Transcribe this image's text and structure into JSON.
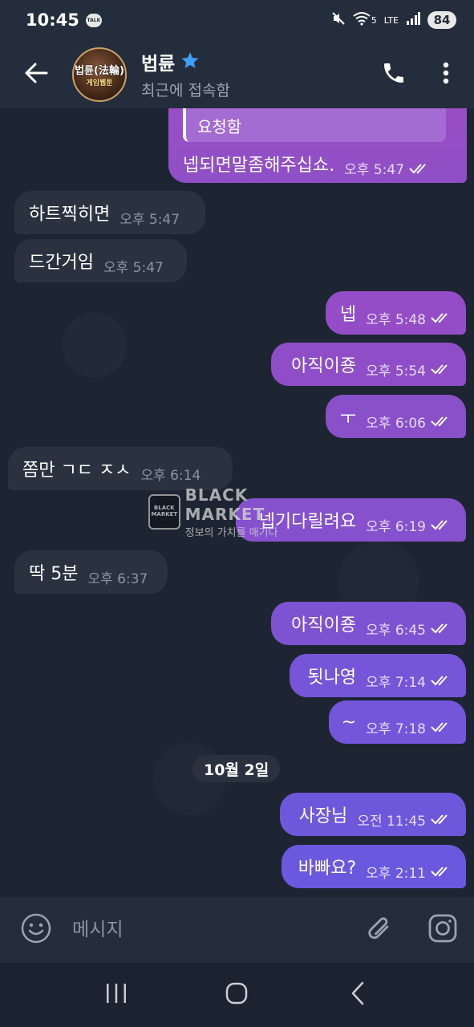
{
  "status_bar": {
    "time": "10:45",
    "talk_badge": "TALK",
    "network": "5",
    "lte": "LTE",
    "battery": "84"
  },
  "header": {
    "name": "법륜",
    "status": "최근에 접속함",
    "avatar_text_1": "법륜(法輪)",
    "avatar_text_2": "게임웹툰"
  },
  "colors": {
    "outgoing_bubble_top": "#9a4ec6",
    "outgoing_bubble_bottom": "#5c5ee6",
    "incoming_bubble": "#2a3240",
    "header_bg": "#242d3b",
    "star": "#3d9ef5"
  },
  "reply_snippet": {
    "quoted": "요청함",
    "text": "넵되면말좀해주십쇼.",
    "time": "오후 5:47"
  },
  "messages": [
    {
      "side": "in",
      "text": "하트찍히면",
      "time": "오후 5:47"
    },
    {
      "side": "in",
      "text": "드간거임",
      "time": "오후 5:47"
    },
    {
      "side": "out",
      "text": "넵",
      "time": "오후 5:48"
    },
    {
      "side": "out",
      "text": "아직이죵",
      "time": "오후 5:54"
    },
    {
      "side": "out",
      "text": "ㅜ",
      "time": "오후 6:06"
    },
    {
      "side": "in",
      "text": "쫌만 ㄱㄷ ㅈㅅ",
      "time": "오후 6:14"
    },
    {
      "side": "out",
      "text": "넵기다릴려요",
      "time": "오후 6:19"
    },
    {
      "side": "in",
      "text": "딱 5분",
      "time": "오후 6:37"
    },
    {
      "side": "out",
      "text": "아직이죵",
      "time": "오후 6:45"
    },
    {
      "side": "out",
      "text": "됫나영",
      "time": "오후 7:14"
    },
    {
      "side": "out",
      "text": "~",
      "time": "오후 7:18"
    },
    {
      "side": "out",
      "text": "사장님",
      "time": "오전 11:45"
    },
    {
      "side": "out",
      "text": "바빠요?",
      "time": "오후 2:11"
    }
  ],
  "date_separator": "10월 2일",
  "watermark": {
    "logo": "BLACK MARKET",
    "title": "BLACK MARKET",
    "subtitle": "정보의 가치를 매기다"
  },
  "input": {
    "placeholder": "메시지"
  },
  "icons": {
    "back": "arrow-left",
    "call": "phone",
    "menu": "more-vertical",
    "emoji": "smiley",
    "attach": "paperclip",
    "camera": "instagram-camera",
    "nav_recent": "three-bars",
    "nav_home": "rounded-square",
    "nav_back": "chevron-left"
  }
}
